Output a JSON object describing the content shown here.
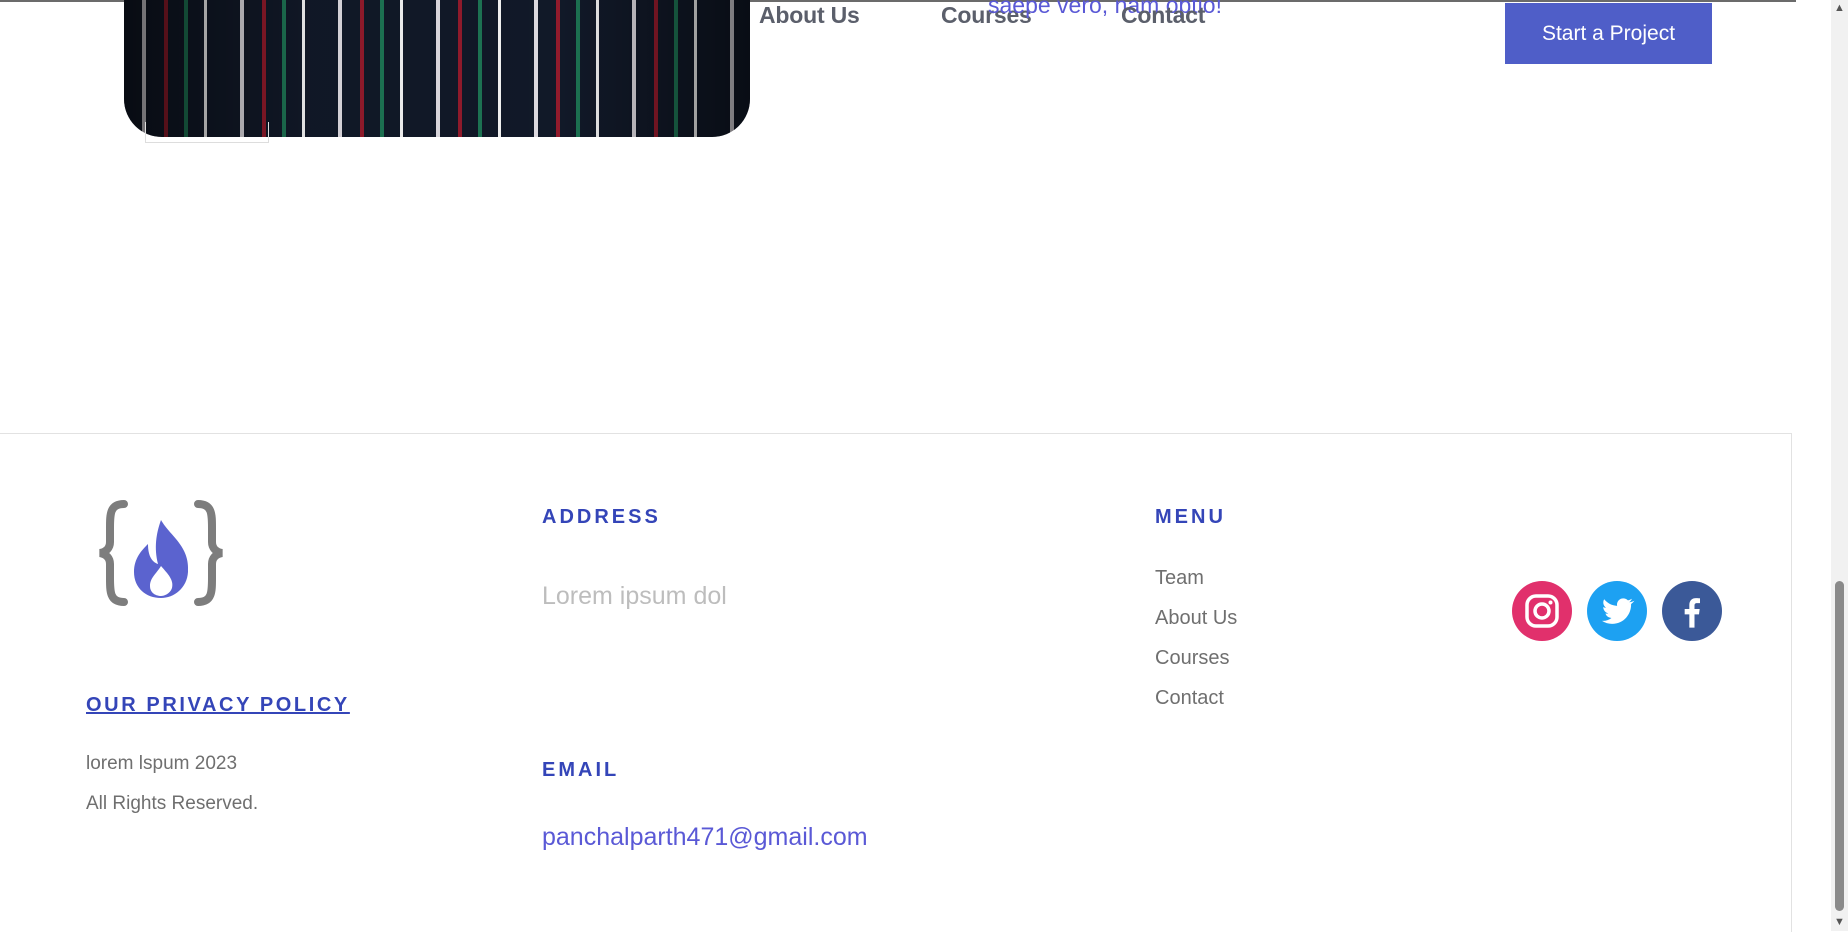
{
  "header": {
    "nav": [
      "About Us",
      "Courses",
      "Contact"
    ],
    "overlap_text": "saepe vero, nam optio!",
    "cta_label": "Start a Project"
  },
  "footer": {
    "privacy_policy": "OUR PRIVACY POLICY",
    "copyright_line1": "lorem lspum 2023",
    "copyright_line2": "All Rights Reserved.",
    "address": {
      "heading": "ADDRESS",
      "text": "Lorem ipsum dol"
    },
    "email": {
      "heading": "EMAIL",
      "value": "panchalparth471@gmail.com"
    },
    "menu": {
      "heading": "MENU",
      "items": [
        "Team",
        "About Us",
        "Courses",
        "Contact"
      ]
    },
    "social": [
      {
        "icon": "instagram-icon",
        "color": "#e1306c"
      },
      {
        "icon": "twitter-icon",
        "color": "#1da1f2"
      },
      {
        "icon": "facebook-icon",
        "color": "#3b5998"
      }
    ]
  },
  "colors": {
    "accent": "#3445b8",
    "button": "#4f5ec8",
    "link": "#5a59d6"
  }
}
